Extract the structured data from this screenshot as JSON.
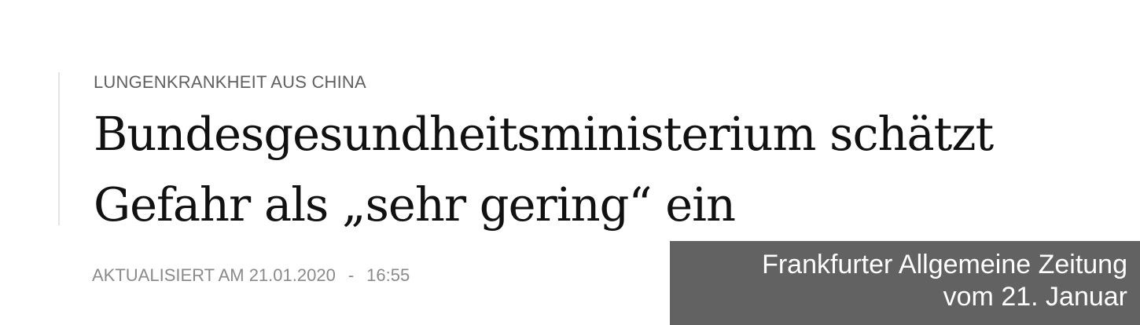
{
  "article": {
    "kicker": "LUNGENKRANKHEIT AUS CHINA",
    "headline_line1": "Bundesgesundheitsministerium schätzt",
    "headline_line2": "Gefahr als „sehr gering“ ein",
    "updated_label": "AKTUALISIERT AM 21.01.2020",
    "separator": "-",
    "time": "16:55"
  },
  "overlay": {
    "line1": "Frankfurter Allgemeine Zeitung",
    "line2": "vom 21. Januar"
  },
  "colors": {
    "overlay_bg": "#626262",
    "headline": "#111111",
    "meta": "#8a8a8a"
  }
}
